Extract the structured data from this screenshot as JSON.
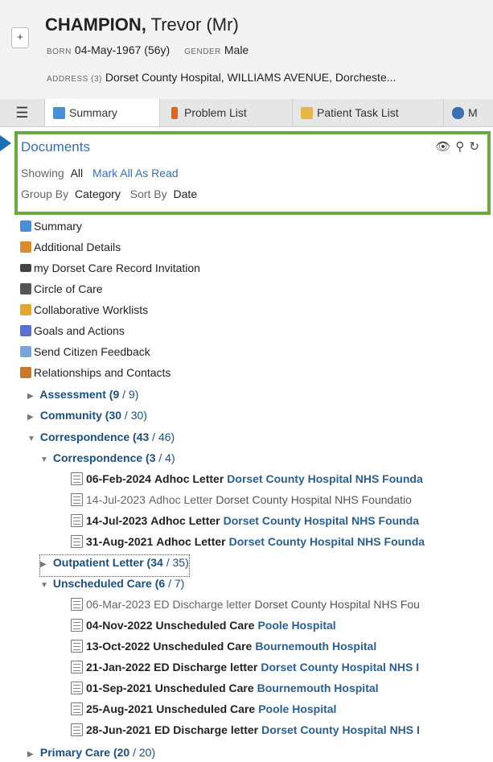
{
  "patient": {
    "surname": "CHAMPION,",
    "forename": "Trevor (Mr)",
    "born_label": "BORN",
    "born_value": "04-May-1967 (56y)",
    "gender_label": "GENDER",
    "gender_value": "Male",
    "address_label": "ADDRESS (3)",
    "address_value": "Dorset County Hospital, WILLIAMS AVENUE, Dorcheste..."
  },
  "header": {
    "expand_label": "+"
  },
  "tabs": [
    {
      "label": "Summary"
    },
    {
      "label": "Problem List"
    },
    {
      "label": "Patient Task List"
    },
    {
      "label": "M"
    }
  ],
  "documents": {
    "title": "Documents",
    "showing_label": "Showing",
    "showing_value": "All",
    "mark_all_label": "Mark All As Read",
    "group_label": "Group By",
    "group_value": "Category",
    "sort_label": "Sort By",
    "sort_value": "Date"
  },
  "nav_items": [
    {
      "label": "Summary",
      "icon": "summary-icon",
      "color": "#4a8fd6"
    },
    {
      "label": "Additional Details",
      "icon": "people-icon",
      "color": "#d98c2b"
    },
    {
      "label": "my Dorset Care Record Invitation",
      "icon": "monitor-icon",
      "color": "#444444"
    },
    {
      "label": "Circle of Care",
      "icon": "group-icon",
      "color": "#555555"
    },
    {
      "label": "Collaborative Worklists",
      "icon": "clipboard-icon",
      "color": "#e0a830"
    },
    {
      "label": "Goals and Actions",
      "icon": "checklist-icon",
      "color": "#5a6fd0"
    },
    {
      "label": "Send Citizen Feedback",
      "icon": "envelope-icon",
      "color": "#7aa5d6"
    },
    {
      "label": "Relationships and Contacts",
      "icon": "contacts-icon",
      "color": "#c87a2a"
    }
  ],
  "groups": {
    "assessment": {
      "label": "Assessment",
      "unread": "9",
      "total": "9"
    },
    "community": {
      "label": "Community",
      "unread": "30",
      "total": "30"
    },
    "correspondence": {
      "label": "Correspondence",
      "unread": "43",
      "total": "46"
    },
    "correspondence_sub": {
      "label": "Correspondence",
      "unread": "3",
      "total": "4"
    },
    "outpatient": {
      "label": "Outpatient Letter",
      "unread": "34",
      "total": "35"
    },
    "unscheduled": {
      "label": "Unscheduled Care",
      "unread": "6",
      "total": "7"
    },
    "primary": {
      "label": "Primary Care",
      "unread": "20",
      "total": "20"
    }
  },
  "correspondence_docs": [
    {
      "date": "06-Feb-2024",
      "type": "Adhoc Letter",
      "org": "Dorset County Hospital NHS Founda"
    },
    {
      "date": "14-Jul-2023",
      "type": "Adhoc Letter",
      "org": "Dorset County Hospital NHS Foundatio"
    },
    {
      "date": "14-Jul-2023",
      "type": "Adhoc Letter",
      "org": "Dorset County Hospital NHS Founda"
    },
    {
      "date": "31-Aug-2021",
      "type": "Adhoc Letter",
      "org": "Dorset County Hospital NHS Founda"
    }
  ],
  "unscheduled_docs": [
    {
      "date": "06-Mar-2023",
      "type": "ED Discharge letter",
      "org": "Dorset County Hospital NHS Fou"
    },
    {
      "date": "04-Nov-2022",
      "type": "Unscheduled Care",
      "org": "Poole Hospital"
    },
    {
      "date": "13-Oct-2022",
      "type": "Unscheduled Care",
      "org": "Bournemouth Hospital"
    },
    {
      "date": "21-Jan-2022",
      "type": "ED Discharge letter",
      "org": "Dorset County Hospital NHS I"
    },
    {
      "date": "01-Sep-2021",
      "type": "Unscheduled Care",
      "org": "Bournemouth Hospital"
    },
    {
      "date": "25-Aug-2021",
      "type": "Unscheduled Care",
      "org": "Poole Hospital"
    },
    {
      "date": "28-Jun-2021",
      "type": "ED Discharge letter",
      "org": "Dorset County Hospital NHS I"
    }
  ],
  "colors": {
    "panel_border": "#6aa842",
    "link": "#3a6fb0",
    "group": "#1d4f7c"
  }
}
